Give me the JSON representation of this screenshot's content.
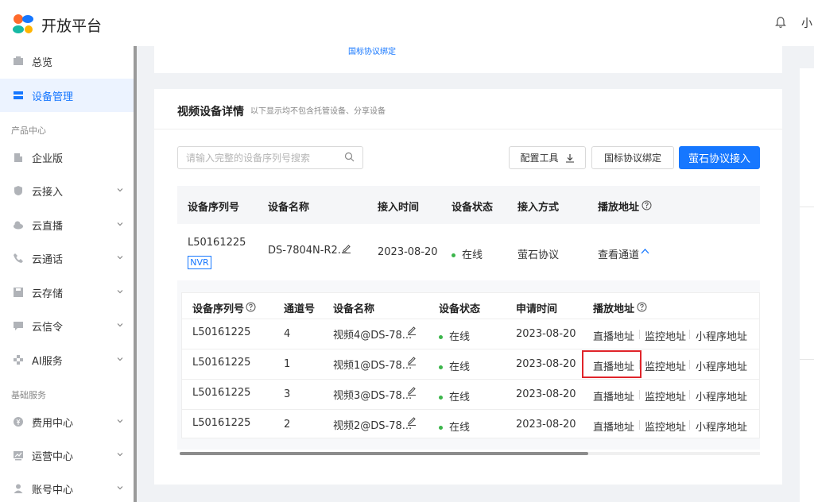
{
  "header": {
    "brand": "开放平台",
    "user_initial": "小"
  },
  "sidebar": {
    "items": [
      {
        "label": "总览",
        "icon": "overview-icon"
      },
      {
        "label": "设备管理",
        "icon": "device-icon",
        "active": true
      },
      {
        "label": "企业版",
        "icon": "enterprise-icon"
      },
      {
        "label": "云接入",
        "icon": "cloud-access-icon",
        "expandable": true
      },
      {
        "label": "云直播",
        "icon": "cloud-live-icon",
        "expandable": true
      },
      {
        "label": "云通话",
        "icon": "cloud-call-icon",
        "expandable": true
      },
      {
        "label": "云存储",
        "icon": "cloud-storage-icon",
        "expandable": true
      },
      {
        "label": "云信令",
        "icon": "cloud-signal-icon",
        "expandable": true
      },
      {
        "label": "AI服务",
        "icon": "ai-icon",
        "expandable": true
      },
      {
        "label": "费用中心",
        "icon": "billing-icon",
        "expandable": true
      },
      {
        "label": "运营中心",
        "icon": "operations-icon",
        "expandable": true
      },
      {
        "label": "账号中心",
        "icon": "account-icon",
        "expandable": true
      }
    ],
    "groups": {
      "product": "产品中心",
      "basic": "基础服务"
    }
  },
  "top_card": {
    "link": "国标协议绑定"
  },
  "section": {
    "title": "视频设备详情",
    "subtitle": "以下显示均不包含托管设备、分享设备",
    "search_placeholder": "请输入完整的设备序列号搜索",
    "buttons": {
      "config_tool": "配置工具",
      "gb_bind": "国标协议绑定",
      "ezviz_access": "萤石协议接入"
    }
  },
  "device_table": {
    "headers": [
      "设备序列号",
      "设备名称",
      "接入时间",
      "设备状态",
      "接入方式",
      "播放地址"
    ],
    "row": {
      "serial": "L50161225",
      "tag": "NVR",
      "name": "DS-7804N-R2...",
      "time": "2023-08-20",
      "status": "在线",
      "access": "萤石协议",
      "play": "查看通道"
    }
  },
  "channel_table": {
    "headers": [
      "设备序列号",
      "通道号",
      "设备名称",
      "设备状态",
      "申请时间",
      "播放地址"
    ],
    "link_labels": {
      "live": "直播地址",
      "monitor": "监控地址",
      "mini": "小程序地址"
    },
    "rows": [
      {
        "serial": "L50161225",
        "channel": "4",
        "name": "视频4@DS-78...",
        "status": "在线",
        "time": "2023-08-20"
      },
      {
        "serial": "L50161225",
        "channel": "1",
        "name": "视频1@DS-78...",
        "status": "在线",
        "time": "2023-08-20"
      },
      {
        "serial": "L50161225",
        "channel": "3",
        "name": "视频3@DS-78...",
        "status": "在线",
        "time": "2023-08-20"
      },
      {
        "serial": "L50161225",
        "channel": "2",
        "name": "视频2@DS-78...",
        "status": "在线",
        "time": "2023-08-20"
      }
    ]
  },
  "colors": {
    "primary": "#1677ff",
    "online": "#3bb54a",
    "highlight": "#e0242a"
  }
}
